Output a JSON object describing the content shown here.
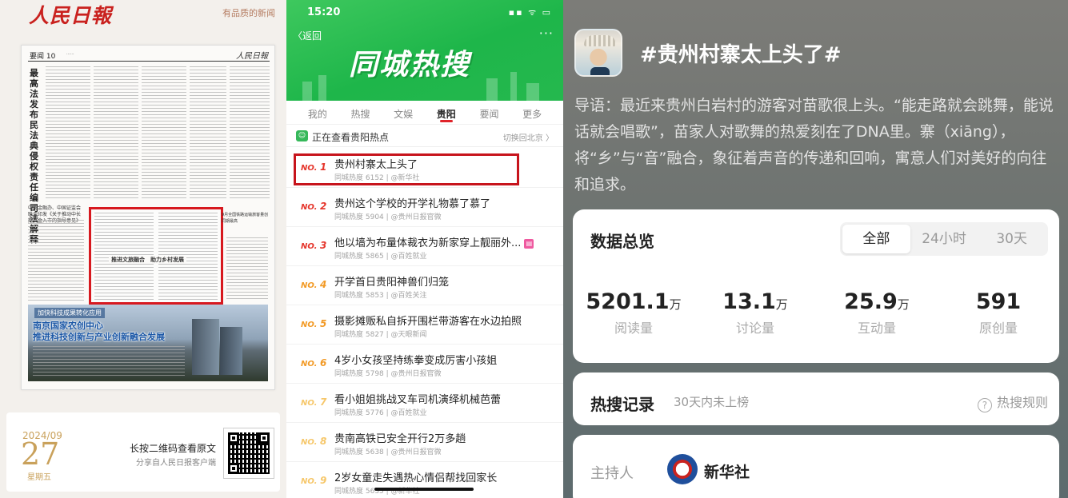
{
  "newspaper": {
    "logo": "人民日報",
    "slogan": "有品质的新闻",
    "section": "要闻 10",
    "masthead": "人民日報",
    "vertical_title": "最高法发布民法典侵权责任编司法解释",
    "sub_headline": "中央金融办、中国证监会联合印发《关于推动中长期资金入市的指导意见》",
    "redbox_title": "推进文旅融合　助力乡村发展",
    "side_headline": "9月全国铁路运输旅客量创同期最高",
    "photo_tag": "加快科技成果转化应用",
    "photo_title1": "南京国家农创中心",
    "photo_title2": "推进科技创新与产业创新融合发展",
    "footer": {
      "year_month": "2024/09",
      "day": "27",
      "weekday": "星期五",
      "long_press": "长按二维码查看原文",
      "share": "分享自人民日报客户端"
    }
  },
  "hotsearch": {
    "status_time": "15:20",
    "status_icons": "▪▪ ᯤ ▭",
    "back_label": "〈返回",
    "more_label": "···",
    "title": "同城热搜",
    "tabs": [
      "我的",
      "热搜",
      "文娱",
      "贵阳",
      "要闻",
      "更多"
    ],
    "active_tab": 3,
    "location_text": "正在查看贵阳热点",
    "switch_text": "切换回北京 〉",
    "items": [
      {
        "rank": "NO.",
        "num": "1",
        "title": "贵州村寨太上头了",
        "meta": "同城热度 6152 | @新华社"
      },
      {
        "rank": "NO.",
        "num": "2",
        "title": "贵州这个学校的开学礼物慕了慕了",
        "meta": "同城热度 5904 | @贵州日报官微"
      },
      {
        "rank": "NO.",
        "num": "3",
        "title": "他以墙为布量体裁衣为新家穿上靓丽外...",
        "meta": "同城热度 5865 | @百姓就业"
      },
      {
        "rank": "NO.",
        "num": "4",
        "title": "开学首日贵阳神兽们归笼",
        "meta": "同城热度 5853 | @百姓关注"
      },
      {
        "rank": "NO.",
        "num": "5",
        "title": "摄影摊贩私自拆开围栏带游客在水边拍照",
        "meta": "同城热度 5827 | @天眼新闻"
      },
      {
        "rank": "NO.",
        "num": "6",
        "title": "4岁小女孩坚持练拳变成厉害小孩姐",
        "meta": "同城热度 5798 | @贵州日报官微"
      },
      {
        "rank": "NO.",
        "num": "7",
        "title": "看小姐姐挑战叉车司机演绎机械芭蕾",
        "meta": "同城热度 5776 | @百姓就业"
      },
      {
        "rank": "NO.",
        "num": "8",
        "title": "贵南高铁已安全开行2万多趟",
        "meta": "同城热度 5638 | @贵州日报官微"
      },
      {
        "rank": "NO.",
        "num": "9",
        "title": "2岁女童走失遇热心情侣帮找回家长",
        "meta": "同城热度 5635 | @新华社"
      }
    ]
  },
  "topic": {
    "title": "#贵州村寨太上头了#",
    "intro": "导语：最近来贵州白岩村的游客对苗歌很上头。“能走路就会跳舞，能说话就会唱歌”，苗家人对歌舞的热爱刻在了DNA里。寨（xiāng），将“乡”与“音”融合，象征着声音的传递和回响，寓意人们对美好的向往和追求。",
    "overview": {
      "heading": "数据总览",
      "segments": [
        "全部",
        "24小时",
        "30天"
      ],
      "stats": [
        {
          "value": "5201.1",
          "unit": "万",
          "label": "阅读量"
        },
        {
          "value": "13.1",
          "unit": "万",
          "label": "讨论量"
        },
        {
          "value": "25.9",
          "unit": "万",
          "label": "互动量"
        },
        {
          "value": "591",
          "unit": "",
          "label": "原创量"
        }
      ]
    },
    "record": {
      "heading": "热搜记录",
      "sub": "30天内未上榜",
      "rule": "热搜规则"
    },
    "host": {
      "label": "主持人",
      "name": "新华社"
    }
  }
}
